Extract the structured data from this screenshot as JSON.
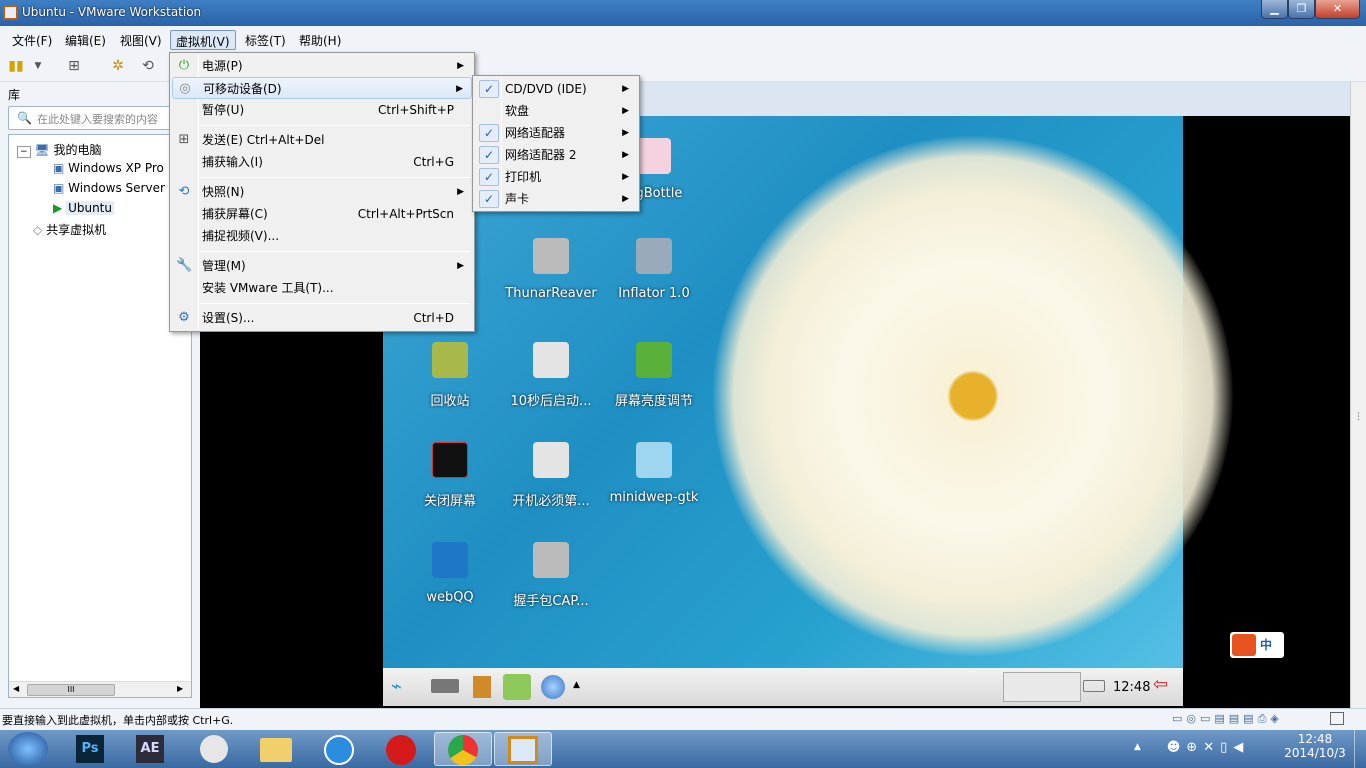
{
  "window": {
    "title": "Ubuntu - VMware Workstation"
  },
  "menubar": [
    "文件(F)",
    "编辑(E)",
    "视图(V)",
    "虚拟机(V)",
    "标签(T)",
    "帮助(H)"
  ],
  "library": {
    "title": "库",
    "search_placeholder": "在此处键入要搜索的内容",
    "tree": [
      "我的电脑",
      "Windows XP Pro",
      "Windows Server",
      "Ubuntu",
      "共享虚拟机"
    ],
    "scroll_grip": "III"
  },
  "vm_menu": [
    {
      "label": "电源(P)",
      "shortcut": "",
      "submenu": true,
      "icon": "power-icon"
    },
    {
      "label": "可移动设备(D)",
      "shortcut": "",
      "submenu": true,
      "icon": "disc-icon"
    },
    {
      "label": "暂停(U)",
      "shortcut": "Ctrl+Shift+P",
      "submenu": false
    },
    {
      "label": "发送(E) Ctrl+Alt+Del",
      "shortcut": "",
      "submenu": false,
      "icon": "network-icon"
    },
    {
      "label": "捕获输入(I)",
      "shortcut": "Ctrl+G",
      "submenu": false
    },
    {
      "label": "快照(N)",
      "shortcut": "",
      "submenu": true,
      "icon": "snapshot-icon"
    },
    {
      "label": "捕获屏幕(C)",
      "shortcut": "Ctrl+Alt+PrtScn",
      "submenu": false
    },
    {
      "label": "捕捉视频(V)...",
      "shortcut": "",
      "submenu": false
    },
    {
      "label": "管理(M)",
      "shortcut": "",
      "submenu": true,
      "icon": "wrench-icon"
    },
    {
      "label": "安装 VMware 工具(T)...",
      "shortcut": "",
      "submenu": false
    },
    {
      "label": "设置(S)...",
      "shortcut": "Ctrl+D",
      "submenu": false,
      "icon": "settings-icon"
    }
  ],
  "devices_menu": [
    {
      "label": "CD/DVD (IDE)",
      "checked": true
    },
    {
      "label": "软盘",
      "checked": false
    },
    {
      "label": "网络适配器",
      "checked": true
    },
    {
      "label": "网络适配器 2",
      "checked": true
    },
    {
      "label": "打印机",
      "checked": true
    },
    {
      "label": "声卡",
      "checked": true
    }
  ],
  "desktop_icons": [
    "ingBottle",
    "ThunarReaver",
    "Inflator 1.0",
    "回收站",
    "10秒后启动...",
    "屏幕亮度调节",
    "关闭屏幕",
    "开机必须第...",
    "minidwep-gtk",
    "webQQ",
    "握手包CAP..."
  ],
  "vm_clock": "12:48",
  "ime": "中",
  "status": "要直接输入到此虚拟机，单击内部或按 Ctrl+G.",
  "clock": {
    "time": "12:48",
    "date": "2014/10/3"
  },
  "taskbar_apps": [
    "Ps",
    "AE"
  ],
  "colors": {
    "titlebar": "#2a62a8",
    "highlight": "#dbe8f8",
    "check": "#1f5fb0"
  }
}
